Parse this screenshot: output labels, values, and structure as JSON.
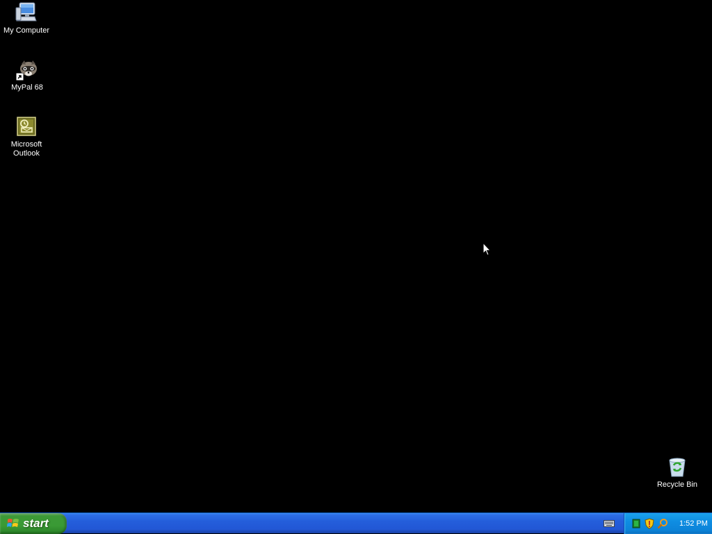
{
  "desktop": {
    "icons": [
      {
        "label": "My Computer",
        "icon": "my-computer-icon"
      },
      {
        "label": "MyPal 68",
        "icon": "mypal-browser-icon",
        "shortcut": true
      },
      {
        "label": "Microsoft Outlook",
        "icon": "outlook-icon"
      },
      {
        "label": "Recycle Bin",
        "icon": "recycle-bin-icon"
      }
    ],
    "background_color": "#000000"
  },
  "taskbar": {
    "start_label": "start",
    "quick_launch": [
      {
        "icon": "keyboard-language-icon"
      }
    ],
    "tray": {
      "icons": [
        "network-icon",
        "security-shield-icon",
        "search-magnifier-icon"
      ],
      "clock": "1:52 PM"
    },
    "colors": {
      "taskbar": "#245edb",
      "start": "#3a9a35",
      "tray": "#0f8de2"
    }
  }
}
